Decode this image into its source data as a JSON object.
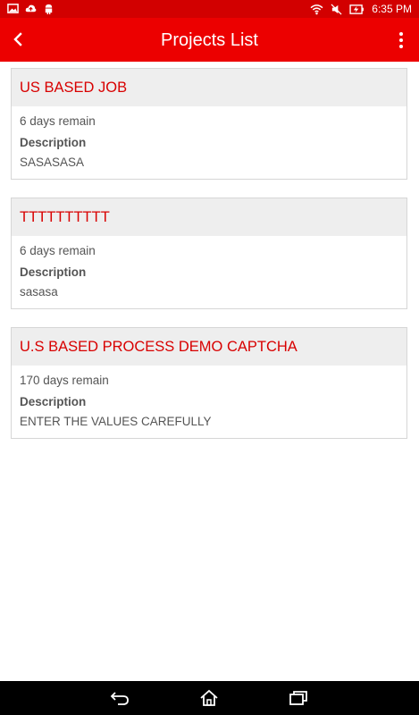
{
  "status_bar": {
    "time": "6:35 PM",
    "left_icons": [
      "image-icon",
      "cloud-icon",
      "android-icon"
    ],
    "right_icons": [
      "wifi-icon",
      "mute-icon",
      "battery-charging-icon"
    ]
  },
  "app_bar": {
    "title": "Projects List",
    "back_icon": "chevron-left-icon",
    "menu_icon": "overflow-menu-icon"
  },
  "projects": [
    {
      "title": "US BASED JOB",
      "days_remain": "6 days remain",
      "description_label": "Description",
      "description": "SASASASA"
    },
    {
      "title": "TTTTTTTTTT",
      "days_remain": "6 days remain",
      "description_label": "Description",
      "description": "sasasa"
    },
    {
      "title": "U.S BASED PROCESS DEMO CAPTCHA",
      "days_remain": "170 days remain",
      "description_label": "Description",
      "description": "ENTER THE VALUES CAREFULLY"
    }
  ],
  "nav_bar": {
    "buttons": [
      "back-icon",
      "home-icon",
      "recents-icon"
    ]
  },
  "colors": {
    "status_bar": "#d20000",
    "app_bar": "#ec0000",
    "card_title": "#d80000",
    "card_header_bg": "#eeeeee"
  }
}
